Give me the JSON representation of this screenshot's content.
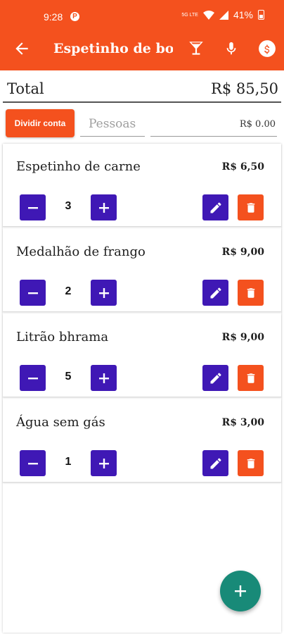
{
  "status_bar": {
    "time": "9:28",
    "p_icon": "P",
    "network": "5G LTE",
    "battery": "41%"
  },
  "app_bar": {
    "title": "Espetinho de bo..."
  },
  "total": {
    "label": "Total",
    "value": "R$ 85,50"
  },
  "split": {
    "button_label": "Dividir conta",
    "people_placeholder": "Pessoas",
    "value": "R$ 0.00"
  },
  "items": [
    {
      "name": "Espetinho de carne",
      "price": "R$ 6,50",
      "qty": "3"
    },
    {
      "name": "Medalhão de frango",
      "price": "R$ 9,00",
      "qty": "2"
    },
    {
      "name": "Litrão bhrama",
      "price": "R$ 9,00",
      "qty": "5"
    },
    {
      "name": "Água sem gás",
      "price": "R$ 3,00",
      "qty": "1"
    }
  ],
  "icons": {
    "back": "arrow-back-icon",
    "glass": "glass-icon",
    "mic": "mic-icon",
    "money": "dollar-icon",
    "minus": "minus-icon",
    "plus": "plus-icon",
    "edit": "pencil-icon",
    "delete": "trash-icon",
    "fab": "add-icon"
  },
  "colors": {
    "primary": "#f4511e",
    "accent": "#3f18b5",
    "fab": "#188a78"
  }
}
